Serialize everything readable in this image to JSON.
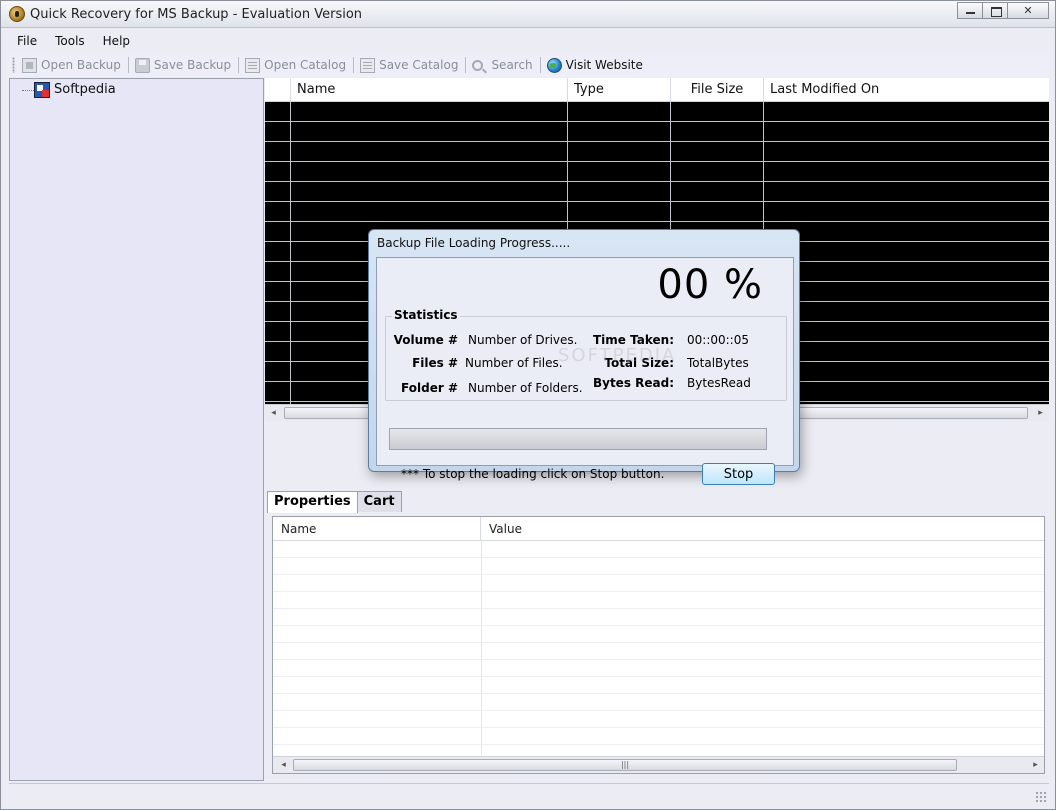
{
  "window": {
    "title": "Quick Recovery for MS Backup -  Evaluation Version"
  },
  "menu": {
    "items": [
      "File",
      "Tools",
      "Help"
    ]
  },
  "toolbar": {
    "open_backup": "Open Backup",
    "save_backup": "Save Backup",
    "open_catalog": "Open Catalog",
    "save_catalog": "Save Catalog",
    "search": "Search",
    "visit_website": "Visit Website"
  },
  "tree": {
    "root": "Softpedia"
  },
  "file_list": {
    "columns": [
      "",
      "Name",
      "Type",
      "File Size",
      "Last Modified On"
    ]
  },
  "tabs": [
    "Properties",
    "Cart"
  ],
  "properties": {
    "columns": [
      "Name",
      "Value"
    ]
  },
  "dialog": {
    "title": "Backup File Loading  Progress.....",
    "percent": "00 %",
    "progress_fraction": 0,
    "stats_title": "Statistics",
    "volume_label": "Volume #",
    "volume_value": "Number of Drives.",
    "files_label": "Files #",
    "files_value": "Number of Files.",
    "folder_label": "Folder #",
    "folder_value": "Number of Folders.",
    "time_label": "Time Taken:",
    "time_value": "00::00::05",
    "size_label": "Total Size:",
    "size_value": "TotalBytes",
    "bytes_label": "Bytes Read:",
    "bytes_value": "BytesRead",
    "hint": "*** To stop the loading click on Stop button.",
    "stop_label": "Stop",
    "watermark": "SOFTPEDIA"
  }
}
